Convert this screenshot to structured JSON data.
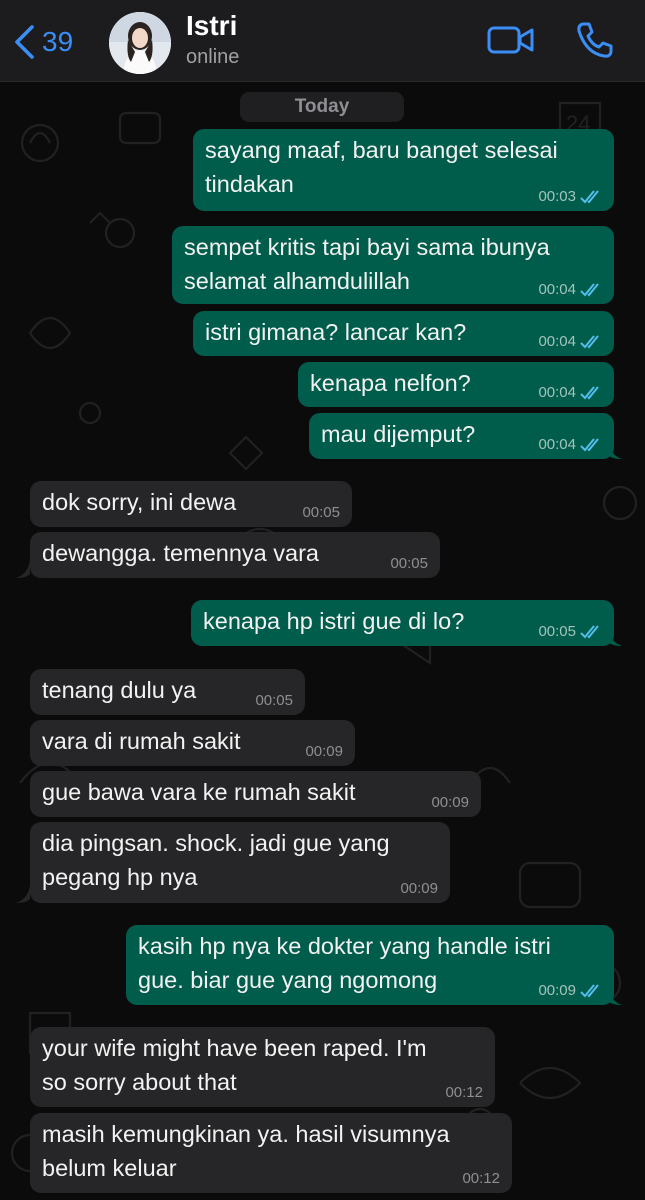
{
  "header": {
    "back_count": "39",
    "contact_name": "Istri",
    "contact_status": "online"
  },
  "date_separator": "Today",
  "colors": {
    "accent": "#3a8ef6",
    "outgoing_bubble": "#005c4b",
    "incoming_bubble": "#262628",
    "read_ticks": "#53bdeb"
  },
  "icons": [
    "chevron-left-icon",
    "video-camera-icon",
    "phone-icon",
    "double-check-icon"
  ],
  "messages": [
    {
      "direction": "out",
      "lines": [
        "sayang maaf, baru banget selesai",
        "tindakan"
      ],
      "time": "00:03",
      "status": "read"
    },
    {
      "direction": "out",
      "lines": [
        "sempet kritis tapi bayi sama ibunya",
        "selamat alhamdulillah"
      ],
      "time": "00:04",
      "status": "read"
    },
    {
      "direction": "out",
      "lines": [
        "istri gimana? lancar kan?"
      ],
      "time": "00:04",
      "status": "read"
    },
    {
      "direction": "out",
      "lines": [
        "kenapa nelfon?"
      ],
      "time": "00:04",
      "status": "read"
    },
    {
      "direction": "out",
      "lines": [
        "mau dijemput?"
      ],
      "time": "00:04",
      "status": "read"
    },
    {
      "direction": "in",
      "lines": [
        "dok sorry, ini dewa"
      ],
      "time": "00:05"
    },
    {
      "direction": "in",
      "lines": [
        "dewangga. temennya vara"
      ],
      "time": "00:05"
    },
    {
      "direction": "out",
      "lines": [
        "kenapa hp istri gue di lo?"
      ],
      "time": "00:05",
      "status": "read"
    },
    {
      "direction": "in",
      "lines": [
        "tenang dulu ya"
      ],
      "time": "00:05"
    },
    {
      "direction": "in",
      "lines": [
        "vara di rumah sakit"
      ],
      "time": "00:09"
    },
    {
      "direction": "in",
      "lines": [
        "gue bawa vara ke rumah sakit"
      ],
      "time": "00:09"
    },
    {
      "direction": "in",
      "lines": [
        "dia pingsan. shock. jadi gue yang",
        "pegang hp nya"
      ],
      "time": "00:09"
    },
    {
      "direction": "out",
      "lines": [
        "kasih hp nya ke dokter yang handle istri",
        "gue. biar gue yang ngomong"
      ],
      "time": "00:09",
      "status": "read"
    },
    {
      "direction": "in",
      "lines": [
        "your wife might have been raped. I'm",
        "so sorry about that"
      ],
      "time": "00:12"
    },
    {
      "direction": "in",
      "lines": [
        "masih kemungkinan ya. hasil visumnya",
        "belum keluar"
      ],
      "time": "00:12"
    }
  ]
}
